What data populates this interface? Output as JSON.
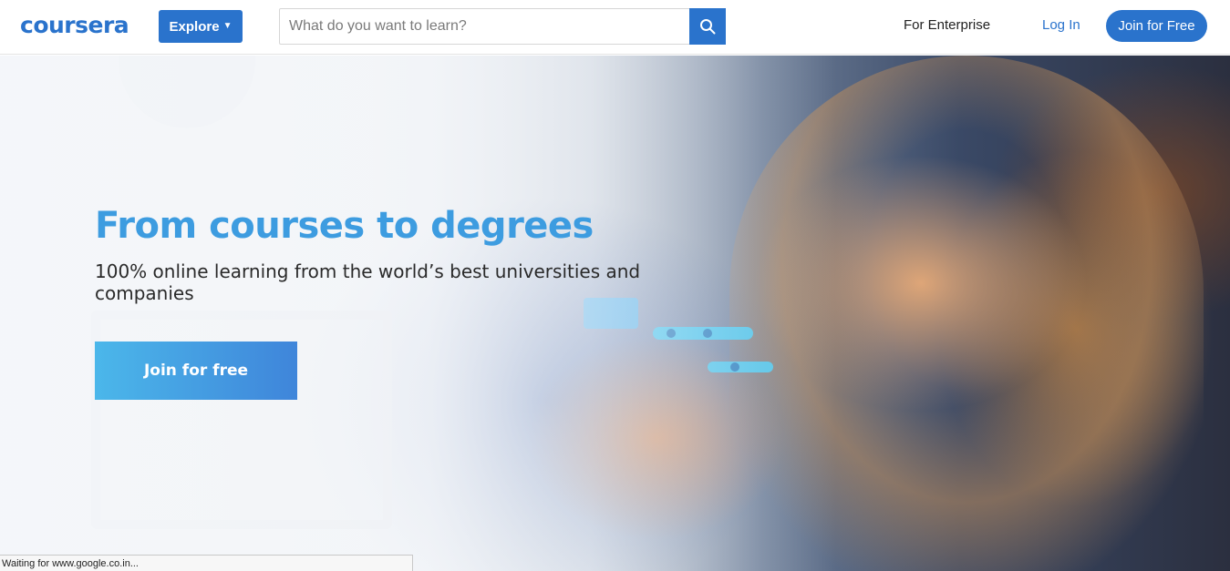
{
  "header": {
    "logo_text": "coursera",
    "explore_label": "Explore",
    "search": {
      "placeholder": "What do you want to learn?",
      "value": ""
    },
    "nav": {
      "enterprise": "For Enterprise",
      "login": "Log In",
      "join": "Join for Free"
    }
  },
  "hero": {
    "title": "From courses to degrees",
    "subtitle": "100% online learning from the world’s best universities and companies",
    "cta_label": "Join for free"
  },
  "status_bar": {
    "text": "Waiting for www.google.co.in..."
  },
  "colors": {
    "brand_blue": "#2a73cc",
    "title_blue": "#3d9ce0",
    "cta_start": "#4bb7ea",
    "cta_end": "#3f85da"
  },
  "icons": {
    "search": "search-icon",
    "explore_chevron": "chevron-down-icon"
  }
}
